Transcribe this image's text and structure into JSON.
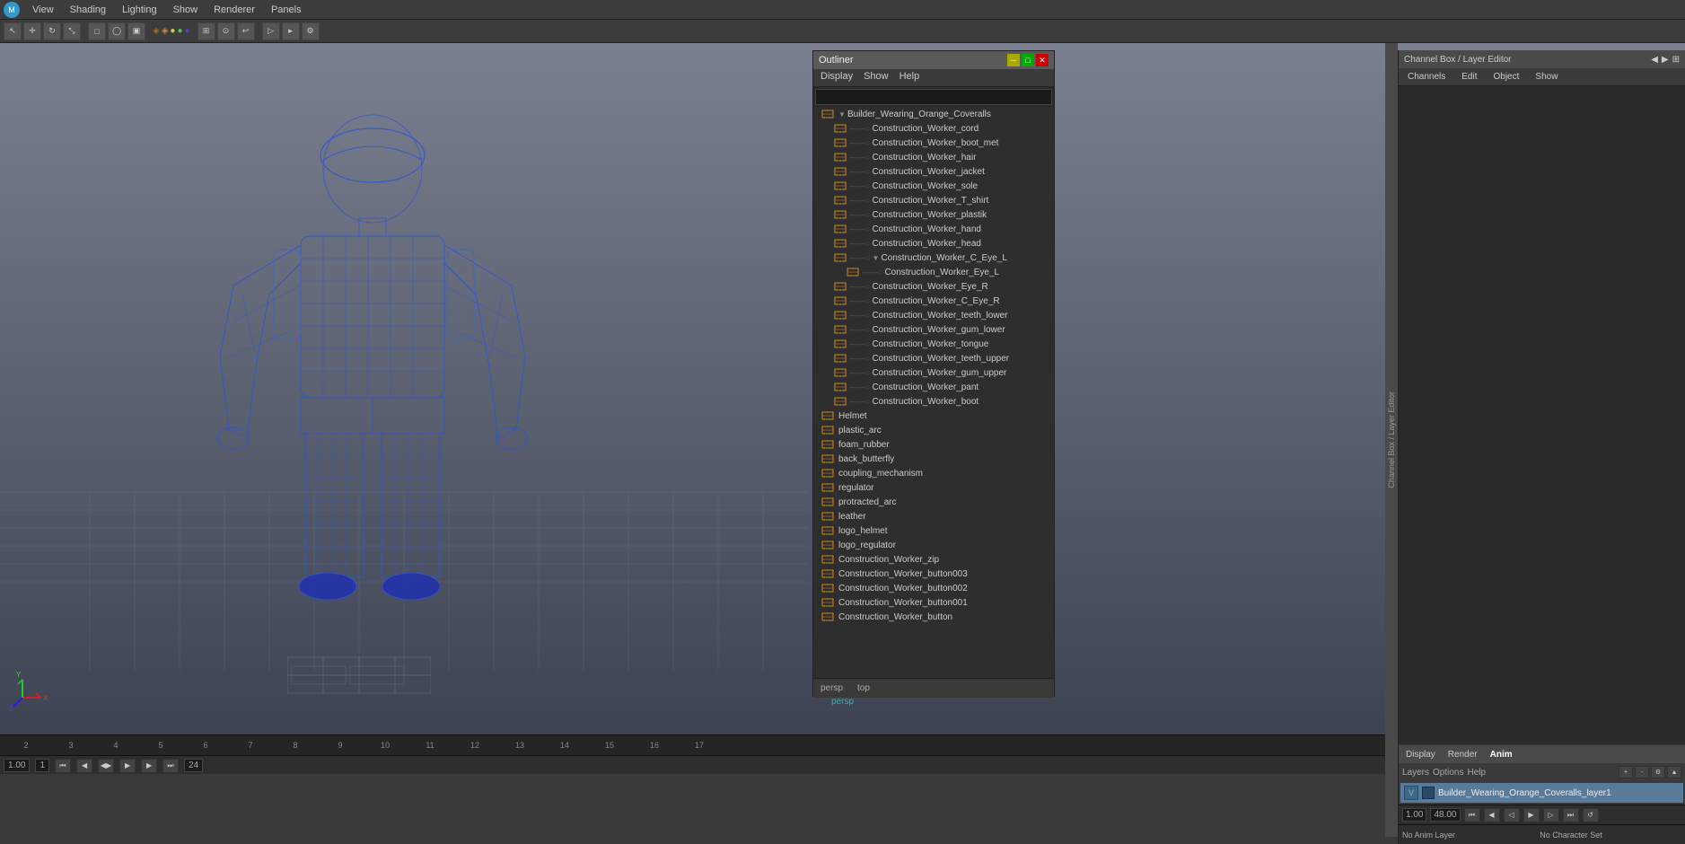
{
  "app": {
    "title": "Autodesk Maya"
  },
  "menu": {
    "items": [
      "View",
      "Shading",
      "Lighting",
      "Show",
      "Renderer",
      "Panels"
    ]
  },
  "viewport": {
    "label": "persp",
    "timeline_numbers": [
      "2",
      "3",
      "4",
      "5",
      "6",
      "7",
      "8",
      "9",
      "10",
      "11",
      "12",
      "13",
      "14",
      "15",
      "16",
      "17"
    ],
    "bottom_left": "1.00",
    "bottom_right": "24"
  },
  "outliner": {
    "title": "Outliner",
    "menu_items": [
      "Display",
      "Show",
      "Help"
    ],
    "search_placeholder": "",
    "items": [
      {
        "label": "Builder_Wearing_Orange_Coveralls",
        "level": 0,
        "icon": "mesh",
        "has_children": true,
        "expanded": true
      },
      {
        "label": "Construction_Worker_cord",
        "level": 1,
        "icon": "mesh"
      },
      {
        "label": "Construction_Worker_boot_met",
        "level": 1,
        "icon": "mesh"
      },
      {
        "label": "Construction_Worker_hair",
        "level": 1,
        "icon": "mesh"
      },
      {
        "label": "Construction_Worker_jacket",
        "level": 1,
        "icon": "mesh"
      },
      {
        "label": "Construction_Worker_sole",
        "level": 1,
        "icon": "mesh"
      },
      {
        "label": "Construction_Worker_T_shirt",
        "level": 1,
        "icon": "mesh"
      },
      {
        "label": "Construction_Worker_plastik",
        "level": 1,
        "icon": "mesh"
      },
      {
        "label": "Construction_Worker_hand",
        "level": 1,
        "icon": "mesh"
      },
      {
        "label": "Construction_Worker_head",
        "level": 1,
        "icon": "mesh"
      },
      {
        "label": "Construction_Worker_C_Eye_L",
        "level": 1,
        "icon": "mesh",
        "has_children": true,
        "expanded": true
      },
      {
        "label": "Construction_Worker_Eye_L",
        "level": 2,
        "icon": "mesh"
      },
      {
        "label": "Construction_Worker_Eye_R",
        "level": 1,
        "icon": "mesh"
      },
      {
        "label": "Construction_Worker_C_Eye_R",
        "level": 1,
        "icon": "mesh"
      },
      {
        "label": "Construction_Worker_teeth_lower",
        "level": 1,
        "icon": "mesh"
      },
      {
        "label": "Construction_Worker_gum_lower",
        "level": 1,
        "icon": "mesh"
      },
      {
        "label": "Construction_Worker_tongue",
        "level": 1,
        "icon": "mesh"
      },
      {
        "label": "Construction_Worker_teeth_upper",
        "level": 1,
        "icon": "mesh"
      },
      {
        "label": "Construction_Worker_gum_upper",
        "level": 1,
        "icon": "mesh"
      },
      {
        "label": "Construction_Worker_pant",
        "level": 1,
        "icon": "mesh"
      },
      {
        "label": "Construction_Worker_boot",
        "level": 1,
        "icon": "mesh"
      },
      {
        "label": "Helmet",
        "level": 0,
        "icon": "mesh"
      },
      {
        "label": "plastic_arc",
        "level": 0,
        "icon": "mesh"
      },
      {
        "label": "foam_rubber",
        "level": 0,
        "icon": "mesh"
      },
      {
        "label": "back_butterfly",
        "level": 0,
        "icon": "mesh"
      },
      {
        "label": "coupling_mechanism",
        "level": 0,
        "icon": "mesh"
      },
      {
        "label": "regulator",
        "level": 0,
        "icon": "mesh"
      },
      {
        "label": "protracted_arc",
        "level": 0,
        "icon": "mesh"
      },
      {
        "label": "leather",
        "level": 0,
        "icon": "mesh"
      },
      {
        "label": "logo_helmet",
        "level": 0,
        "icon": "mesh"
      },
      {
        "label": "logo_regulator",
        "level": 0,
        "icon": "mesh"
      },
      {
        "label": "Construction_Worker_zip",
        "level": 0,
        "icon": "mesh"
      },
      {
        "label": "Construction_Worker_button003",
        "level": 0,
        "icon": "mesh"
      },
      {
        "label": "Construction_Worker_button002",
        "level": 0,
        "icon": "mesh"
      },
      {
        "label": "Construction_Worker_button001",
        "level": 0,
        "icon": "mesh"
      },
      {
        "label": "Construction_Worker_button",
        "level": 0,
        "icon": "mesh"
      }
    ],
    "bottom_items": [
      "persp",
      "top"
    ]
  },
  "channel_box": {
    "header": "Channel Box / Layer Editor",
    "tabs": [
      "Channels",
      "Edit",
      "Object",
      "Show"
    ],
    "layer_tabs": [
      "Display",
      "Render",
      "Anim"
    ],
    "layer_options": [
      "Layers",
      "Options",
      "Help"
    ],
    "active_layer_tab": "Anim",
    "layer_item": "Builder_Wearing_Orange_Coveralls_layer1",
    "layer_vis_label": "V"
  },
  "bottom_bar": {
    "frame_start": "1.00",
    "frame_marker": "1",
    "frame_end": "24",
    "anim_layer": "No Anim Layer",
    "character_set": "No Character Set",
    "time_start": "1.00",
    "time_end": "24.00",
    "time_current": "48.00"
  },
  "icons": {
    "minimize": "─",
    "maximize": "□",
    "close": "✕",
    "expand": "▶",
    "collapse": "▼",
    "mesh": "◈",
    "camera": "📷",
    "arrow_left": "◄",
    "arrow_right": "►",
    "play": "▶",
    "stop": "■",
    "rewind": "◀◀",
    "fastforward": "▶▶"
  }
}
